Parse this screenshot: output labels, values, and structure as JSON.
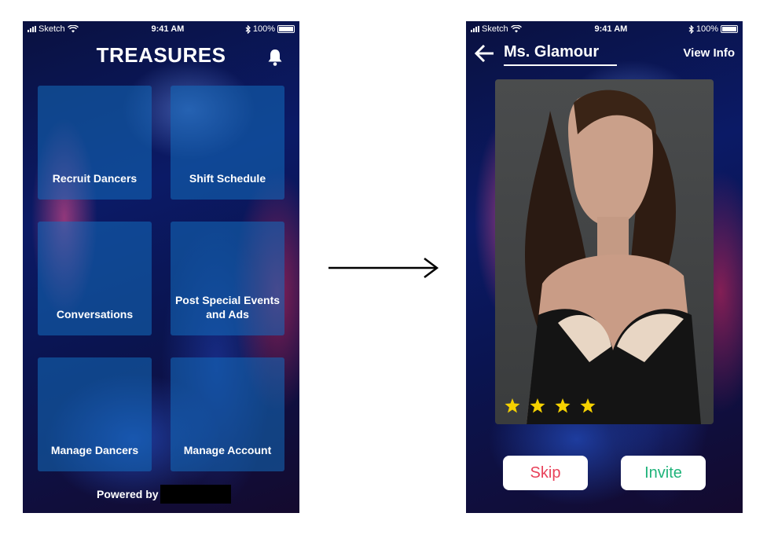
{
  "status_bar": {
    "carrier": "Sketch",
    "time": "9:41 AM",
    "battery": "100%"
  },
  "home": {
    "title": "TREASURES",
    "tiles": [
      {
        "label": "Recruit Dancers"
      },
      {
        "label": "Shift Schedule"
      },
      {
        "label": "Conversations"
      },
      {
        "label": "Post Special Events and Ads"
      },
      {
        "label": "Manage Dancers"
      },
      {
        "label": "Manage Account"
      }
    ],
    "powered_by": "Powered by"
  },
  "profile": {
    "name": "Ms. Glamour",
    "view_info": "View Info",
    "rating": 4,
    "skip_label": "Skip",
    "invite_label": "Invite"
  },
  "colors": {
    "skip": "#e8425a",
    "invite": "#1fb37a",
    "star": "#f5d100",
    "tile": "rgba(20,110,190,0.55)"
  }
}
